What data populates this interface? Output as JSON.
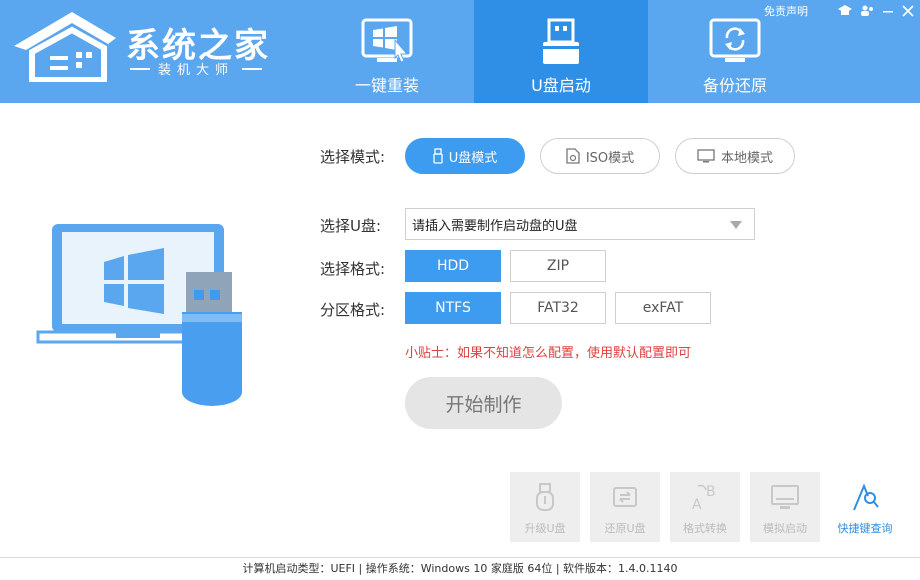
{
  "header": {
    "logo_title": "系统之家",
    "logo_subtitle": "装机大师",
    "top_link": "免责声明",
    "tabs": [
      {
        "label": "一键重装",
        "icon": "windows-cursor-icon",
        "active": false
      },
      {
        "label": "U盘启动",
        "icon": "usb-drive-icon",
        "active": true
      },
      {
        "label": "备份还原",
        "icon": "restore-icon",
        "active": false
      }
    ]
  },
  "mode": {
    "label": "选择模式:",
    "options": [
      {
        "label": "U盘模式",
        "icon": "usb-small-icon",
        "active": true
      },
      {
        "label": "ISO模式",
        "icon": "iso-file-icon",
        "active": false
      },
      {
        "label": "本地模式",
        "icon": "monitor-icon",
        "active": false
      }
    ]
  },
  "usb": {
    "label": "选择U盘:",
    "value": "请插入需要制作启动盘的U盘"
  },
  "format": {
    "label": "选择格式:",
    "options": [
      {
        "label": "HDD",
        "active": true
      },
      {
        "label": "ZIP",
        "active": false
      }
    ]
  },
  "partition": {
    "label": "分区格式:",
    "options": [
      {
        "label": "NTFS",
        "active": true
      },
      {
        "label": "FAT32",
        "active": false
      },
      {
        "label": "exFAT",
        "active": false
      }
    ]
  },
  "tip": "小贴士：如果不知道怎么配置，使用默认配置即可",
  "start_button": "开始制作",
  "tools": [
    {
      "label": "升级U盘",
      "icon": "usb-upgrade-icon",
      "enabled": false
    },
    {
      "label": "还原U盘",
      "icon": "usb-restore-icon",
      "enabled": false
    },
    {
      "label": "格式转换",
      "icon": "format-convert-icon",
      "enabled": false
    },
    {
      "label": "模拟启动",
      "icon": "simulate-boot-icon",
      "enabled": false
    },
    {
      "label": "快捷键查询",
      "icon": "shortcut-search-icon",
      "enabled": true
    }
  ],
  "footer": {
    "status": "计算机启动类型：UEFI | 操作系统：Windows 10 家庭版 64位 | 软件版本：1.4.0.1140"
  },
  "colors": {
    "header_bg": "#5aa6ef",
    "active_tab": "#2f8ee5",
    "accent": "#3d9bf0",
    "tip_red": "#e04040"
  }
}
